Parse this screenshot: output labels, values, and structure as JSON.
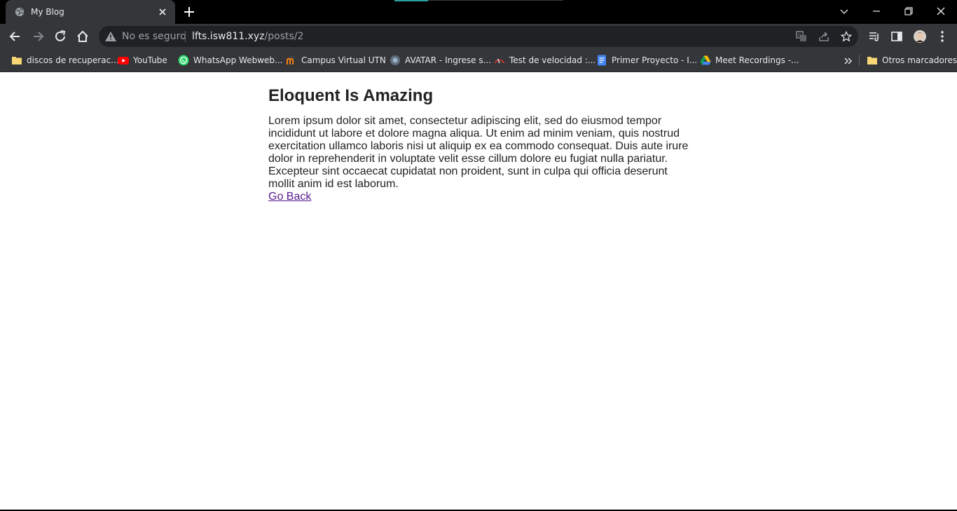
{
  "browser": {
    "tab_title": "My Blog",
    "security_label": "No es seguro",
    "url_host": "lfts.isw811.xyz",
    "url_path": "/posts/2"
  },
  "bookmarks": [
    {
      "label": "discos de recuperac...",
      "icon": "folder-icon"
    },
    {
      "label": "YouTube",
      "icon": "youtube-icon"
    },
    {
      "label": "WhatsApp Webweb...",
      "icon": "whatsapp-icon"
    },
    {
      "label": "Campus Virtual UTN",
      "icon": "moodle-icon"
    },
    {
      "label": "AVATAR - Ingrese s...",
      "icon": "avatar-site-icon"
    },
    {
      "label": "Test de velocidad :...",
      "icon": "speedometer-icon"
    },
    {
      "label": "Primer Proyecto - I...",
      "icon": "docs-icon"
    },
    {
      "label": "Meet Recordings -...",
      "icon": "drive-icon"
    }
  ],
  "other_bookmarks_label": "Otros marcadores",
  "post": {
    "title": "Eloquent Is Amazing",
    "body": "Lorem ipsum dolor sit amet, consectetur adipiscing elit, sed do eiusmod tempor incididunt ut labore et dolore magna aliqua. Ut enim ad minim veniam, quis nostrud exercitation ullamco laboris nisi ut aliquip ex ea commodo consequat. Duis aute irure dolor in reprehenderit in voluptate velit esse cillum dolore eu fugiat nulla pariatur. Excepteur sint occaecat cupidatat non proident, sunt in culpa qui officia deserunt mollit anim id est laborum.",
    "back_link": "Go Back"
  },
  "colors": {
    "chrome_dark": "#35363a",
    "titlebar": "#000000",
    "omnibox": "#202124",
    "visited_link": "#551a8b",
    "text": "#222222"
  }
}
